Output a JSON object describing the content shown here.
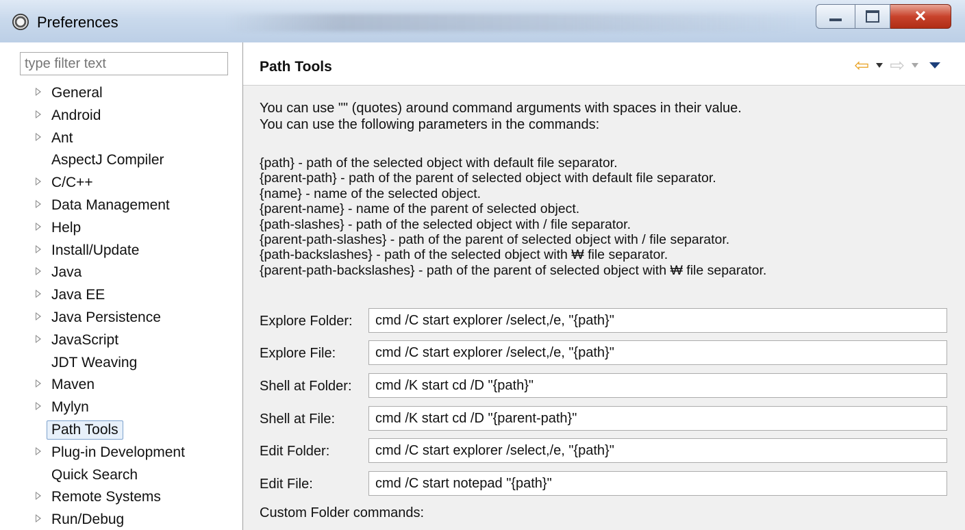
{
  "window": {
    "title": "Preferences"
  },
  "filter": {
    "placeholder": "type filter text"
  },
  "tree": [
    {
      "label": "General",
      "expandable": true
    },
    {
      "label": "Android",
      "expandable": true
    },
    {
      "label": "Ant",
      "expandable": true
    },
    {
      "label": "AspectJ Compiler",
      "expandable": false
    },
    {
      "label": "C/C++",
      "expandable": true
    },
    {
      "label": "Data Management",
      "expandable": true
    },
    {
      "label": "Help",
      "expandable": true
    },
    {
      "label": "Install/Update",
      "expandable": true
    },
    {
      "label": "Java",
      "expandable": true
    },
    {
      "label": "Java EE",
      "expandable": true
    },
    {
      "label": "Java Persistence",
      "expandable": true
    },
    {
      "label": "JavaScript",
      "expandable": true
    },
    {
      "label": "JDT Weaving",
      "expandable": false
    },
    {
      "label": "Maven",
      "expandable": true
    },
    {
      "label": "Mylyn",
      "expandable": true
    },
    {
      "label": "Path Tools",
      "expandable": false,
      "selected": true
    },
    {
      "label": "Plug-in Development",
      "expandable": true
    },
    {
      "label": "Quick Search",
      "expandable": false
    },
    {
      "label": "Remote Systems",
      "expandable": true
    },
    {
      "label": "Run/Debug",
      "expandable": true
    }
  ],
  "page": {
    "title": "Path Tools",
    "description": [
      "You can use \"\" (quotes) around command arguments with spaces in their value.",
      "You can use the following parameters in the commands:"
    ],
    "parameters": [
      "{path}  - path of the selected object with default file separator.",
      "{parent-path}  - path of the parent of selected object with default file separator.",
      "{name}  - name of the selected object.",
      "{parent-name}  - name of the parent of selected object.",
      "{path-slashes}  - path of the selected object with / file separator.",
      "{parent-path-slashes}  - path of the parent of selected object with / file separator.",
      "{path-backslashes}  - path of the selected object with ₩ file separator.",
      "{parent-path-backslashes} - path of the parent of selected object with ₩ file separator."
    ],
    "commands": [
      {
        "label": "Explore Folder:",
        "value": "cmd /C start explorer /select,/e, \"{path}\""
      },
      {
        "label": "Explore File:",
        "value": "cmd /C start explorer /select,/e, \"{path}\""
      },
      {
        "label": "Shell at Folder:",
        "value": "cmd /K start cd /D \"{path}\""
      },
      {
        "label": "Shell at File:",
        "value": "cmd /K start cd /D \"{parent-path}\""
      },
      {
        "label": "Edit Folder:",
        "value": "cmd /C start explorer /select,/e, \"{path}\""
      },
      {
        "label": "Edit File:",
        "value": "cmd /C start notepad \"{path}\""
      }
    ],
    "custom_label": "Custom Folder commands:"
  },
  "nav": {
    "back_icon": "back-arrow-icon",
    "forward_icon": "forward-arrow-icon",
    "back_color": "#e8a020",
    "forward_color": "#c9c9c9"
  }
}
